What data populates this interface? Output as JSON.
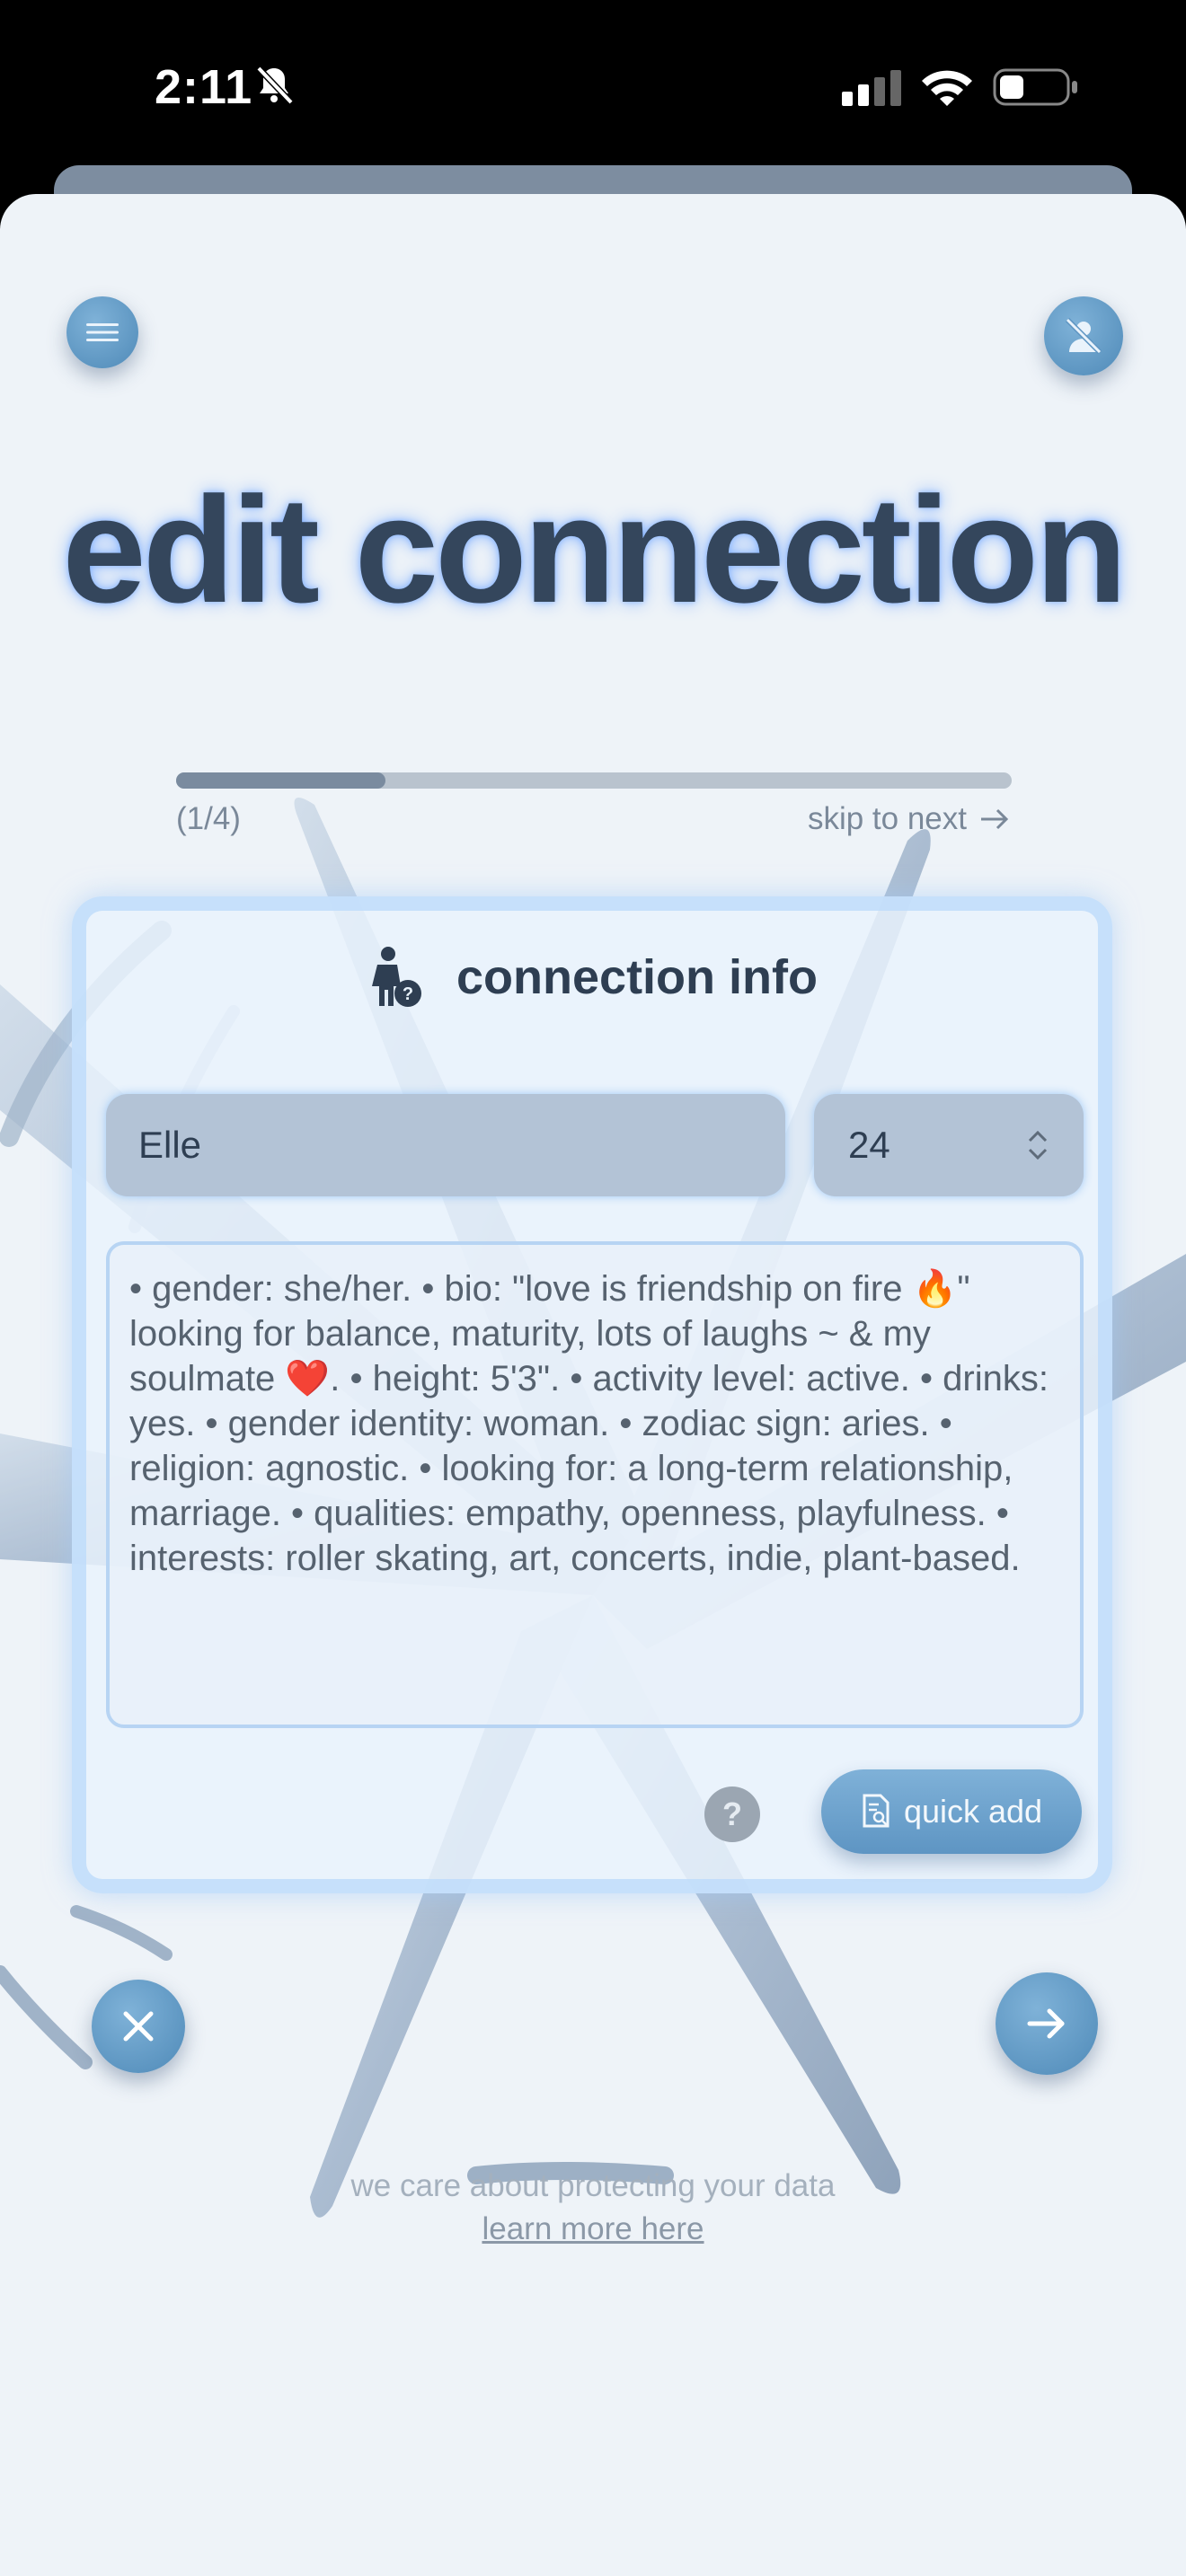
{
  "status_bar": {
    "time": "2:11",
    "icons": [
      "bell-slash-icon",
      "cellular-signal-icon",
      "wifi-icon",
      "battery-icon"
    ]
  },
  "header": {
    "menu_icon": "hamburger-menu-icon",
    "profile_icon": "person-slash-icon",
    "title": "edit connection"
  },
  "progress": {
    "step_label": "(1/4)",
    "fraction": 0.25,
    "skip_label": "skip to next"
  },
  "card": {
    "title": "connection info",
    "icon": "person-question-icon",
    "name_value": "Elle",
    "age_value": "24",
    "bio_value": "• gender: she/her. • bio: \"love is friendship on fire 🔥\" looking for balance, maturity, lots of laughs ~ & my soulmate ❤️. • height: 5'3\". • activity level: active. • drinks: yes. • gender identity: woman. • zodiac sign: aries. • religion: agnostic. • looking for: a long-term relationship, marriage. • qualities: empathy, openness, playfulness. • interests: roller skating, art, concerts, indie, plant-based.",
    "help_label": "?",
    "quick_add_label": "quick add"
  },
  "footer": {
    "privacy_text": "we care about protecting your data",
    "learn_more_label": "learn more here"
  },
  "colors": {
    "accent": "#5e95c3",
    "title_text": "#34465c",
    "sheet_bg": "#eef3f8"
  }
}
